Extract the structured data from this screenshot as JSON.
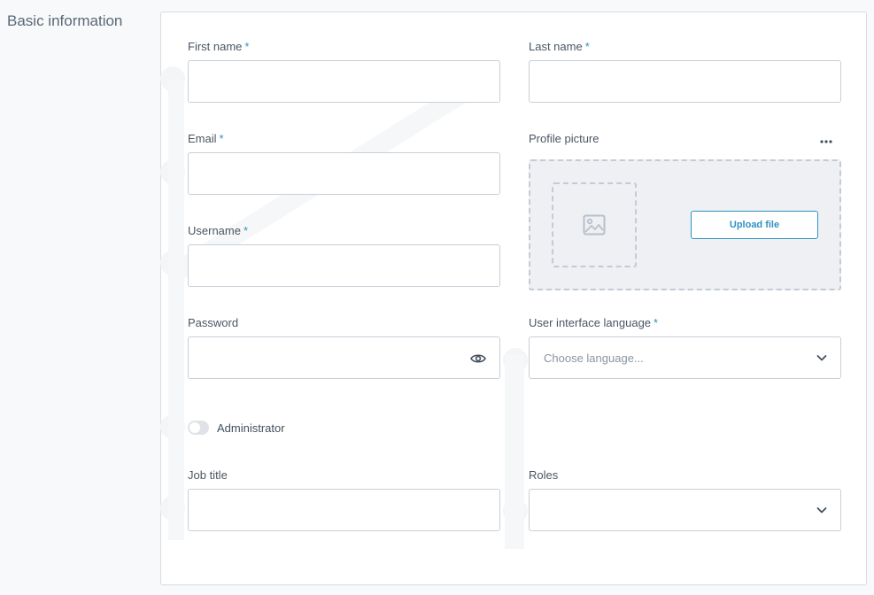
{
  "section": {
    "title": "Basic information"
  },
  "form": {
    "first_name": {
      "label": "First name",
      "required": "*",
      "value": ""
    },
    "last_name": {
      "label": "Last name",
      "required": "*",
      "value": ""
    },
    "email": {
      "label": "Email",
      "required": "*",
      "value": ""
    },
    "username": {
      "label": "Username",
      "required": "*",
      "value": ""
    },
    "password": {
      "label": "Password",
      "value": ""
    },
    "profile_picture": {
      "label": "Profile picture",
      "upload_label": "Upload file",
      "menu_icon": "more-dots-icon"
    },
    "ui_language": {
      "label": "User interface language",
      "required": "*",
      "placeholder": "Choose language..."
    },
    "administrator": {
      "label": "Administrator",
      "checked": false
    },
    "job_title": {
      "label": "Job title",
      "value": ""
    },
    "roles": {
      "label": "Roles",
      "value": ""
    }
  },
  "colors": {
    "accent": "#2f93c1",
    "border": "#c8cfd7",
    "dropzone_bg": "#eef0f4",
    "page_bg": "#f8f9fb"
  }
}
